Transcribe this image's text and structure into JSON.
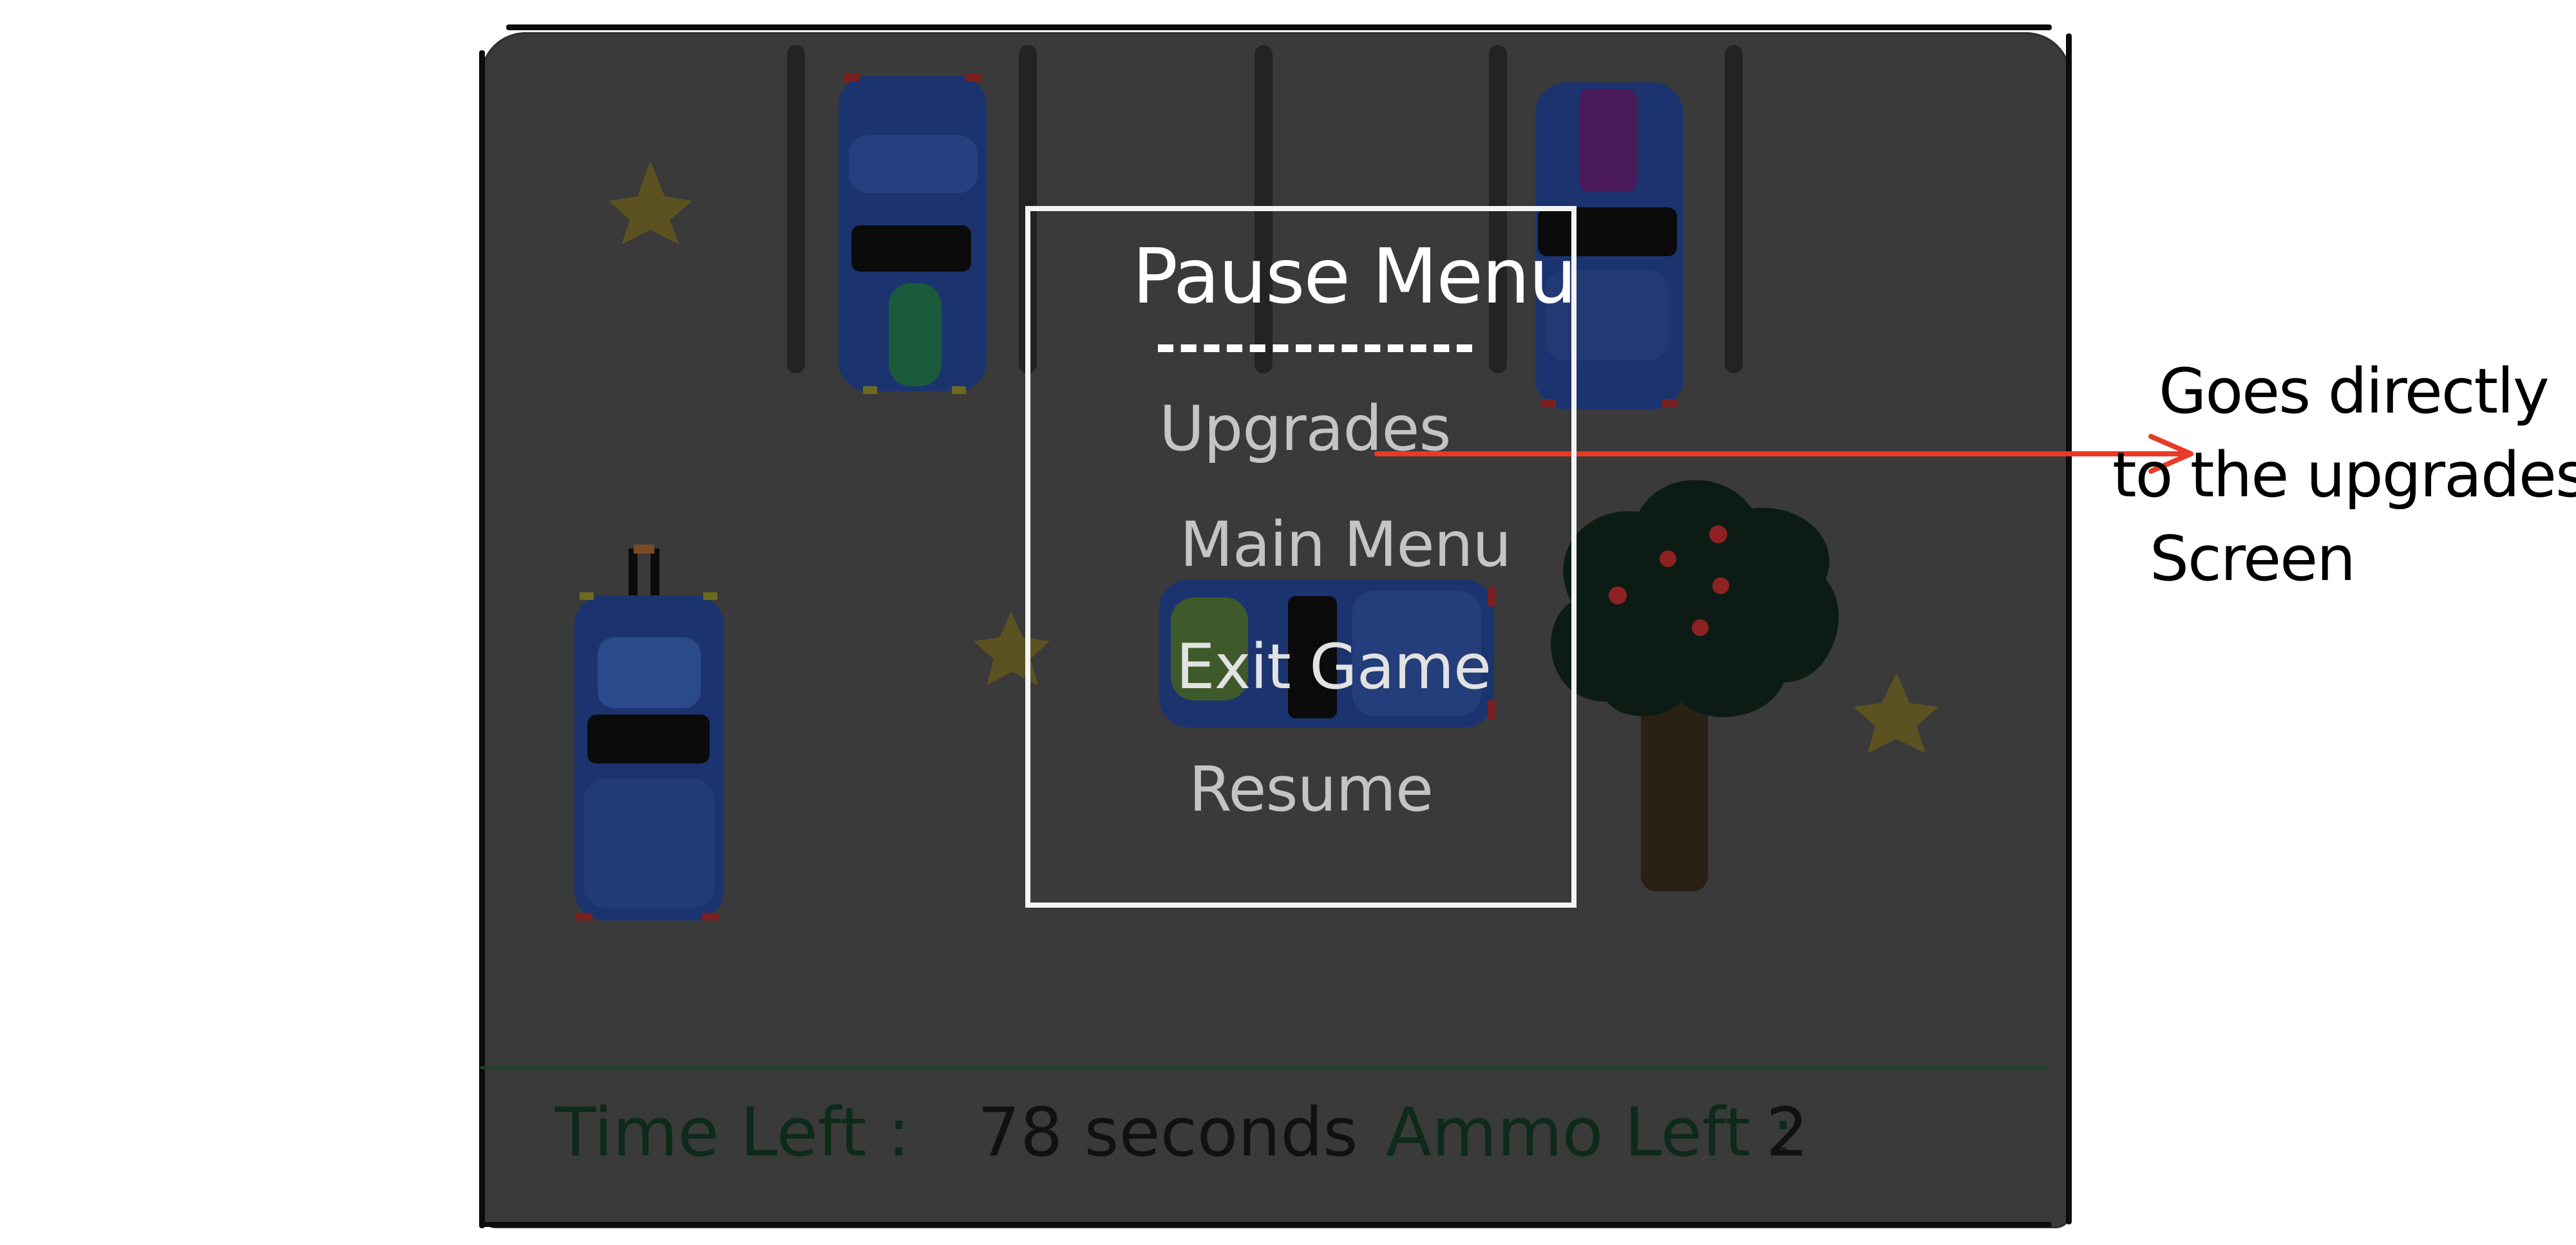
{
  "pause_menu": {
    "title": "Pause Menu",
    "items": [
      {
        "id": "upgrades",
        "label": "Upgrades"
      },
      {
        "id": "main_menu",
        "label": "Main Menu"
      },
      {
        "id": "exit_game",
        "label": "Exit Game"
      },
      {
        "id": "resume",
        "label": "Resume"
      }
    ]
  },
  "hud": {
    "time_label": "Time Left :",
    "time_value": "78 seconds",
    "ammo_label": "Ammo Left :",
    "ammo_value": "2"
  },
  "annotation": {
    "lines": [
      "Goes directly",
      "to the upgrades",
      "Screen"
    ],
    "arrow_color": "#e83a26"
  },
  "colors": {
    "background_dim": "#3a3a3a",
    "menu_border": "#f4f4f4",
    "hud_text": "#0e2a1a",
    "car_body": "#1b3470",
    "star": "#5c5221",
    "tree_canopy": "#0c1c14",
    "tree_trunk": "#2b2016",
    "apples": "#8e2222"
  },
  "scene_objects": [
    {
      "kind": "car",
      "name": "car-parked-1"
    },
    {
      "kind": "car",
      "name": "car-parked-2"
    },
    {
      "kind": "car",
      "name": "car-player"
    },
    {
      "kind": "car",
      "name": "car-moving"
    },
    {
      "kind": "tree",
      "name": "apple-tree"
    },
    {
      "kind": "star",
      "name": "star-1"
    },
    {
      "kind": "star",
      "name": "star-2"
    },
    {
      "kind": "star",
      "name": "star-3"
    }
  ]
}
